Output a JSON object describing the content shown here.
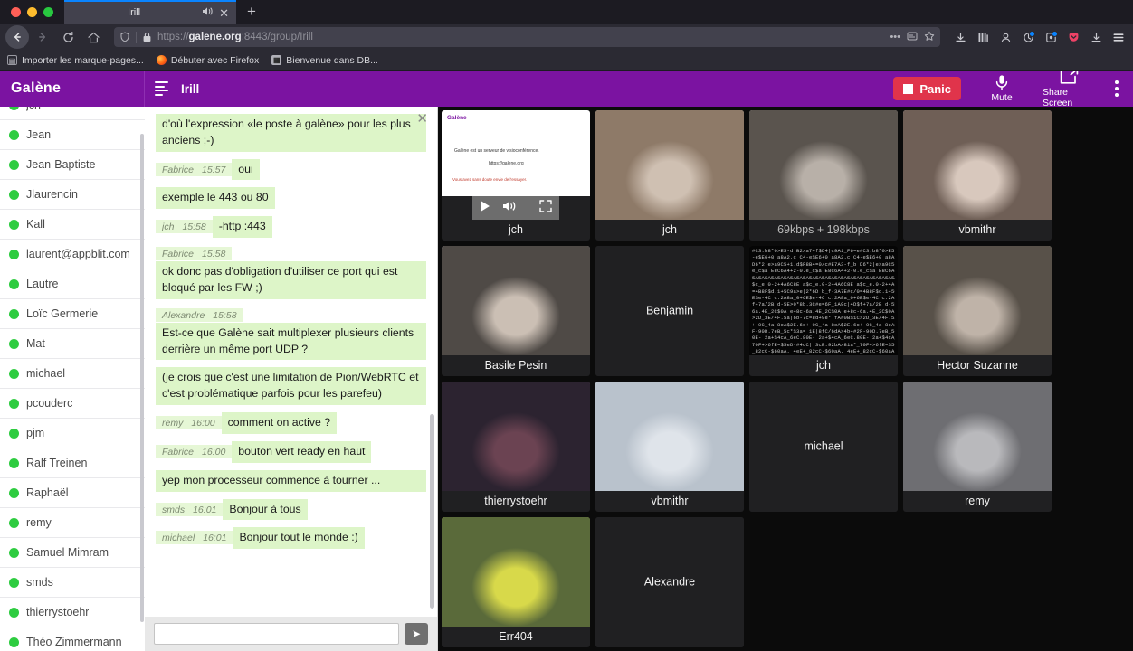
{
  "browser": {
    "tab": {
      "title": "Irill",
      "audio_icon": "speaker-icon",
      "close_icon": "close-icon"
    },
    "new_tab_label": "+",
    "nav": {
      "back": "←",
      "forward": "→",
      "reload": "⟳",
      "home": "⌂"
    },
    "url": {
      "scheme": "https://",
      "host": "galene.org",
      "rest": ":8443/group/Irill",
      "shield_icon": "shield-icon",
      "lock_icon": "lock-icon",
      "more_icon": "ellipsis-icon",
      "reader_icon": "reader-icon",
      "bookmark_icon": "star-icon"
    },
    "toolbar_icons": [
      "download-icon",
      "library-icon",
      "account-icon",
      "sync-icon",
      "extension-icon",
      "pocket-icon",
      "save-icon",
      "menu-icon"
    ],
    "bookmarks": [
      {
        "label": "Importer les marque-pages...",
        "icon": "import-bookmarks-icon"
      },
      {
        "label": "Débuter avec Firefox",
        "icon": "firefox-icon"
      },
      {
        "label": "Bienvenue dans DB...",
        "icon": "db-icon"
      }
    ]
  },
  "app": {
    "brand": "Galène",
    "room": "Irill",
    "collapse_icon": "sidebar-toggle-icon",
    "panic_label": "Panic",
    "mute_label": "Mute",
    "share_label": "Share Screen",
    "menu_icon": "kebab-menu-icon",
    "accent_purple": "#7b13a1",
    "panic_red": "#e0344b",
    "presence_green": "#2ecc40"
  },
  "users": [
    {
      "name": "jch",
      "status": "online"
    },
    {
      "name": "Jean",
      "status": "online"
    },
    {
      "name": "Jean-Baptiste",
      "status": "online"
    },
    {
      "name": "Jlaurencin",
      "status": "online"
    },
    {
      "name": "Kall",
      "status": "online"
    },
    {
      "name": "laurent@appblit.com",
      "status": "online"
    },
    {
      "name": "Lautre",
      "status": "online"
    },
    {
      "name": "Loïc Germerie",
      "status": "online"
    },
    {
      "name": "Mat",
      "status": "online"
    },
    {
      "name": "michael",
      "status": "online"
    },
    {
      "name": "pcouderc",
      "status": "online"
    },
    {
      "name": "pjm",
      "status": "online"
    },
    {
      "name": "Ralf Treinen",
      "status": "online"
    },
    {
      "name": "Raphaël",
      "status": "online"
    },
    {
      "name": "remy",
      "status": "online"
    },
    {
      "name": "Samuel Mimram",
      "status": "online"
    },
    {
      "name": "smds",
      "status": "online"
    },
    {
      "name": "thierrystoehr",
      "status": "online"
    },
    {
      "name": "Théo Zimmermann",
      "status": "online"
    }
  ],
  "chat": {
    "close_icon": "close-icon",
    "input_value": "",
    "input_placeholder": "",
    "send_label": "➤",
    "messages": [
      {
        "who": "",
        "time": "",
        "text": "d'où l'expression «le poste à galène» pour les plus anciens ;-)"
      },
      {
        "who": "Fabrice",
        "time": "15:57",
        "text": "oui"
      },
      {
        "who": "",
        "time": "",
        "text": "exemple le 443 ou 80"
      },
      {
        "who": "jch",
        "time": "15:58",
        "text": "-http :443"
      },
      {
        "who": "Fabrice",
        "time": "15:58",
        "text": "ok donc pas d'obligation d'utiliser ce port qui est bloqué par les FW ;)"
      },
      {
        "who": "Alexandre",
        "time": "15:58",
        "text": "Est-ce que Galène sait multiplexer plusieurs clients derrière un même port UDP ?"
      },
      {
        "who": "",
        "time": "",
        "text": "(je crois que c'est une limitation de Pion/WebRTC et c'est problématique parfois pour les parefeu)"
      },
      {
        "who": "remy",
        "time": "16:00",
        "text": "comment on active ?"
      },
      {
        "who": "Fabrice",
        "time": "16:00",
        "text": "bouton vert ready en haut"
      },
      {
        "who": "",
        "time": "",
        "text": "yep mon processeur commence à tourner ..."
      },
      {
        "who": "smds",
        "time": "16:01",
        "text": "Bonjour à tous"
      },
      {
        "who": "michael",
        "time": "16:01",
        "text": "Bonjour tout le monde :)"
      }
    ]
  },
  "video_grid": {
    "tiles": [
      {
        "label": "jch",
        "kind": "screenshare",
        "slide": {
          "title": "Galène",
          "line1": "Galène est un serveur de visioconférence.",
          "line2": "https://galene.org",
          "line3": "Vous avez sans doute envie de l'essayer."
        },
        "controls": {
          "play": "play-icon",
          "volume": "volume-icon",
          "fullscreen": "fullscreen-icon"
        }
      },
      {
        "label": "jch",
        "kind": "camera"
      },
      {
        "label": "69kbps + 198kbps",
        "kind": "camera",
        "is_stats": true
      },
      {
        "label": "vbmithr",
        "kind": "camera"
      },
      {
        "label": "Basile Pesin",
        "kind": "camera"
      },
      {
        "label": "Benjamin",
        "kind": "audio-only"
      },
      {
        "label": "jch",
        "kind": "terminal"
      },
      {
        "label": "Hector Suzanne",
        "kind": "camera"
      },
      {
        "label": "thierrystoehr",
        "kind": "camera"
      },
      {
        "label": "vbmithr",
        "kind": "camera"
      },
      {
        "label": "michael",
        "kind": "audio-only"
      },
      {
        "label": "remy",
        "kind": "camera"
      },
      {
        "label": "Err404",
        "kind": "camera"
      },
      {
        "label": "Alexandre",
        "kind": "audio-only"
      }
    ]
  }
}
